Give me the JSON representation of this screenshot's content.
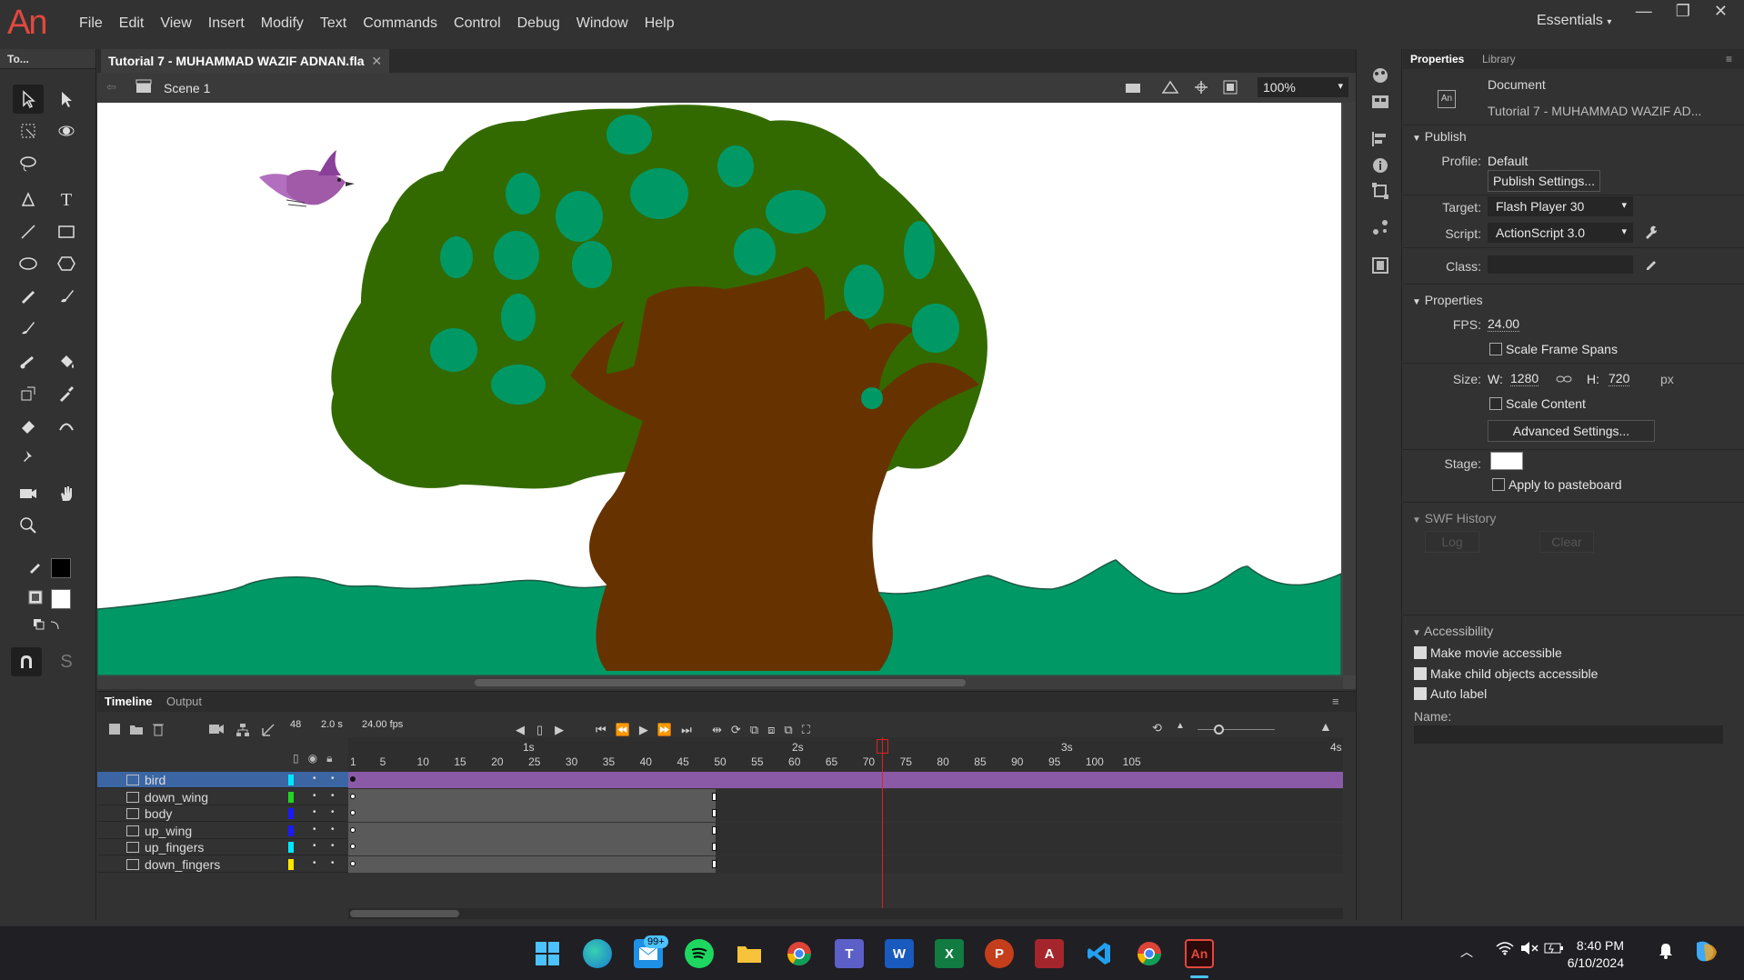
{
  "app": {
    "logo": "An"
  },
  "menu": [
    "File",
    "Edit",
    "View",
    "Insert",
    "Modify",
    "Text",
    "Commands",
    "Control",
    "Debug",
    "Window",
    "Help"
  ],
  "workspace": "Essentials",
  "window_controls": {
    "minimize": "—",
    "restore": "❐",
    "close": "✕"
  },
  "toolbar": {
    "title": "To..."
  },
  "document": {
    "tab_title": "Tutorial 7 - MUHAMMAD WAZIF ADNAN.fla",
    "tab_close": "✕",
    "scene": "Scene 1",
    "zoom": "100%"
  },
  "timeline": {
    "tabs": [
      "Timeline",
      "Output"
    ],
    "current_frame": "48",
    "time": "2.0 s",
    "fps": "24.00 fps",
    "second_markers": [
      "1s",
      "2s",
      "3s",
      "4s"
    ],
    "frame_numbers": [
      "1",
      "5",
      "10",
      "15",
      "20",
      "25",
      "30",
      "35",
      "40",
      "45",
      "50",
      "55",
      "60",
      "65",
      "70",
      "75",
      "80",
      "85",
      "90",
      "95",
      "100",
      "105"
    ],
    "playhead_frame": 48,
    "layers": [
      {
        "name": "bird",
        "color": "#00e6ff",
        "selected": true
      },
      {
        "name": "down_wing",
        "color": "#22d322",
        "selected": false
      },
      {
        "name": "body",
        "color": "#1a1aff",
        "selected": false
      },
      {
        "name": "up_wing",
        "color": "#1a1aff",
        "selected": false
      },
      {
        "name": "up_fingers",
        "color": "#00e6ff",
        "selected": false
      },
      {
        "name": "down_fingers",
        "color": "#ffe600",
        "selected": false
      }
    ]
  },
  "properties": {
    "tabs": [
      "Properties",
      "Library"
    ],
    "doc_type": "Document",
    "doc_name": "Tutorial 7 - MUHAMMAD WAZIF AD...",
    "publish": {
      "header": "Publish",
      "profile_label": "Profile:",
      "profile_value": "Default",
      "publish_settings_btn": "Publish Settings...",
      "target_label": "Target:",
      "target_value": "Flash Player 30",
      "script_label": "Script:",
      "script_value": "ActionScript 3.0",
      "class_label": "Class:"
    },
    "props": {
      "header": "Properties",
      "fps_label": "FPS:",
      "fps_value": "24.00",
      "scale_frame_spans": "Scale Frame Spans",
      "size_label": "Size:",
      "w_label": "W:",
      "w_value": "1280",
      "h_label": "H:",
      "h_value": "720",
      "unit": "px",
      "scale_content": "Scale Content",
      "advanced_btn": "Advanced Settings...",
      "stage_label": "Stage:",
      "stage_color": "#ffffff",
      "apply_pasteboard": "Apply to pasteboard"
    },
    "swf": {
      "header": "SWF History",
      "log_btn": "Log",
      "clear_btn": "Clear"
    },
    "accessibility": {
      "header": "Accessibility",
      "make_accessible": "Make movie accessible",
      "make_child": "Make child objects accessible",
      "auto_label": "Auto label",
      "name_label": "Name:"
    }
  },
  "taskbar": {
    "mail_badge": "99+",
    "time": "8:40 PM",
    "date": "6/10/2024",
    "icons": [
      "windows-start",
      "edge",
      "mail",
      "spotify",
      "file-explorer",
      "chrome",
      "teams",
      "word",
      "excel",
      "powerpoint",
      "access",
      "vscode",
      "chrome",
      "animate"
    ]
  },
  "colors": {
    "tree_foliage": "#336a00",
    "tree_trunk": "#663300",
    "leaf_spots": "#009966",
    "ground": "#009966",
    "bird": "#a05aa8",
    "selection": "#3b66a3",
    "bird_span": "#8a5aa6"
  }
}
